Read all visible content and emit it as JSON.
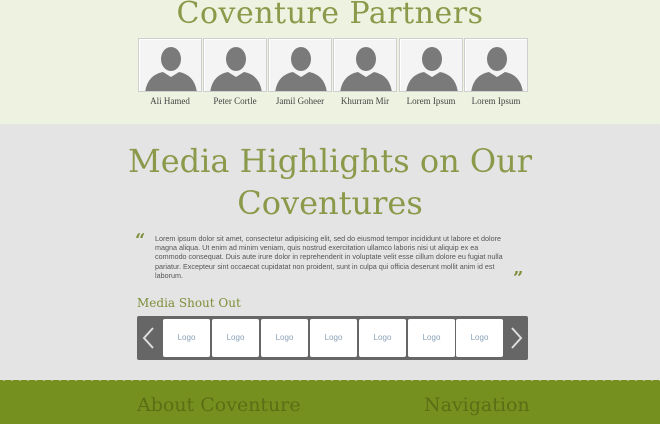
{
  "partners": {
    "title": "Coventure Partners",
    "people": [
      {
        "name": "Ali Hamed"
      },
      {
        "name": "Peter Cortle"
      },
      {
        "name": "Jamil Goheer"
      },
      {
        "name": "Khurram Mir"
      },
      {
        "name": "Lorem Ipsum"
      },
      {
        "name": "Lorem Ipsum"
      }
    ]
  },
  "media": {
    "title_line1": "Media Highlights on Our",
    "title_line2": "Coventures",
    "quote_open": "“",
    "quote_close": "”",
    "quote_text": "Lorem ipsum dolor sit amet, consectetur adipisicing elit, sed do eiusmod tempor incididunt ut labore et dolore magna aliqua. Ut enim ad minim veniam, quis nostrud exercitation ullamco laboris nisi ut aliquip ex ea commodo consequat. Duis aute irure dolor in reprehenderit in voluptate velit esse cillum dolore eu fugiat nulla pariatur. Excepteur sint occaecat cupidatat non proident, sunt in culpa qui officia deserunt mollit anim id est laborum.",
    "shout_label": "Media Shout Out",
    "carousel": {
      "prev_icon": "chevron-left-icon",
      "next_icon": "chevron-right-icon",
      "logos": [
        "Logo",
        "Logo",
        "Logo",
        "Logo",
        "Logo",
        "Logo",
        "Logo"
      ]
    }
  },
  "footer": {
    "about_heading": "About Coventure",
    "nav_heading": "Navigation"
  },
  "colors": {
    "accent": "#8a9a4a",
    "partners_bg": "#eef2e0",
    "media_bg": "#e4e4e4",
    "footer_bg": "#76901f",
    "carousel_bg": "#666666"
  }
}
